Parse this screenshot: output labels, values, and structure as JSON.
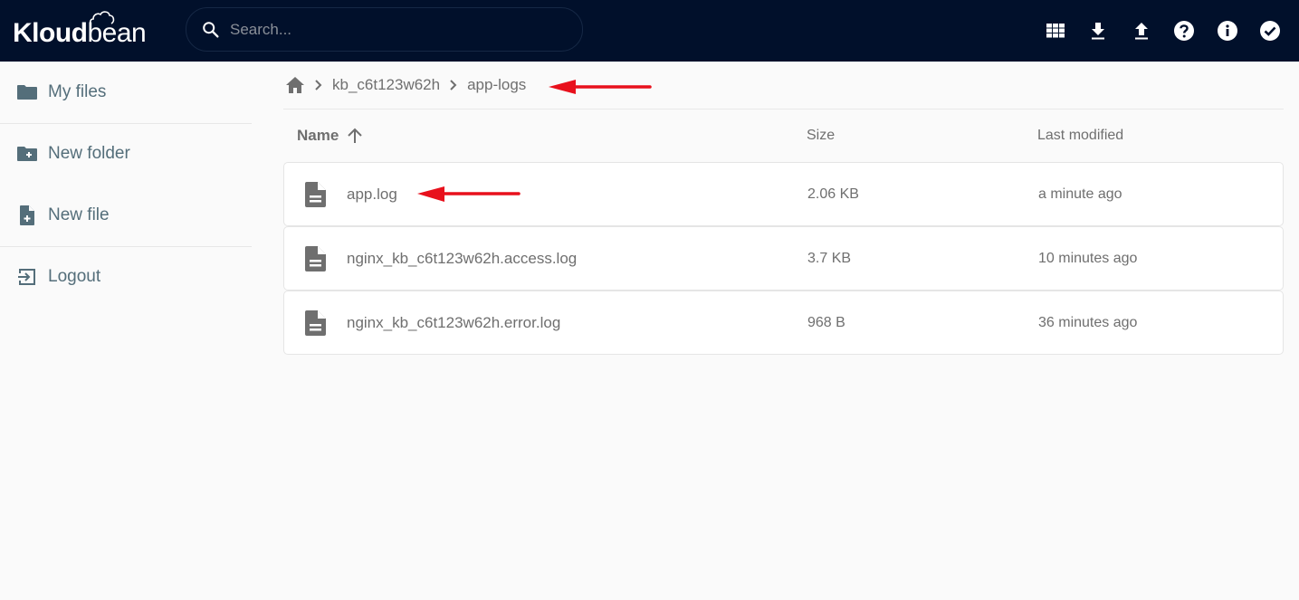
{
  "app": {
    "logo_bold": "Klou",
    "logo_d": "d",
    "logo_rest": "bean"
  },
  "search": {
    "placeholder": "Search...",
    "value": ""
  },
  "toolbar": {
    "icons": [
      "grid-view-icon",
      "download-icon",
      "upload-icon",
      "help-icon",
      "info-icon",
      "select-check-icon"
    ]
  },
  "sidebar": {
    "items": [
      {
        "label": "My files",
        "icon": "folder-icon"
      },
      {
        "label": "New folder",
        "icon": "folder-plus-icon"
      },
      {
        "label": "New file",
        "icon": "file-plus-icon"
      },
      {
        "label": "Logout",
        "icon": "logout-icon"
      }
    ]
  },
  "breadcrumb": {
    "items": [
      "kb_c6t123w62h",
      "app-logs"
    ]
  },
  "table": {
    "columns": {
      "name": "Name",
      "size": "Size",
      "modified": "Last modified"
    },
    "sort": "ascending",
    "rows": [
      {
        "name": "app.log",
        "size": "2.06 KB",
        "modified": "a minute ago"
      },
      {
        "name": "nginx_kb_c6t123w62h.access.log",
        "size": "3.7 KB",
        "modified": "10 minutes ago"
      },
      {
        "name": "nginx_kb_c6t123w62h.error.log",
        "size": "968 B",
        "modified": "36 minutes ago"
      }
    ]
  },
  "colors": {
    "topbar": "#01102b",
    "sidebar_text": "#546e7a",
    "annotation_arrow": "#e8101c"
  }
}
